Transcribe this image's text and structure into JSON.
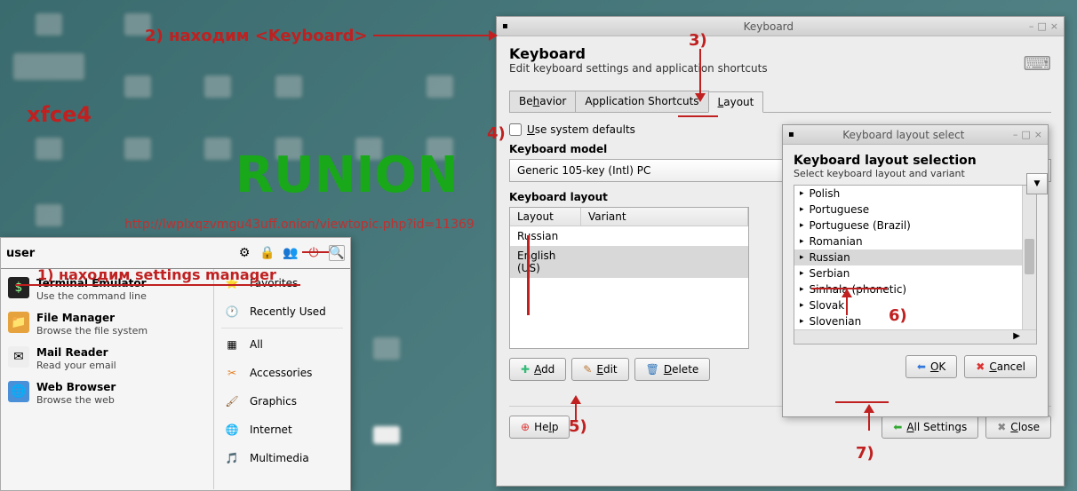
{
  "watermark": "RUNION",
  "watermark_url": "http://lwplxqzvmgu43uff.onion/viewtopic.php?id=11369",
  "xfce4_label": "xfce4",
  "annotations": {
    "a1": "1) находим settings manager",
    "a2": "2) находим <Keyboard>",
    "a3": "3)",
    "a4": "4)",
    "a5": "5)",
    "a6": "6)",
    "a7": "7)"
  },
  "menu": {
    "header_label": "user",
    "apps": [
      {
        "title": "Terminal Emulator",
        "sub": "Use the command line"
      },
      {
        "title": "File Manager",
        "sub": "Browse the file system"
      },
      {
        "title": "Mail Reader",
        "sub": "Read your email"
      },
      {
        "title": "Web Browser",
        "sub": "Browse the web"
      }
    ],
    "categories": [
      "Favorites",
      "Recently Used",
      "All",
      "Accessories",
      "Graphics",
      "Internet",
      "Multimedia"
    ]
  },
  "kbd": {
    "titlebar": "Keyboard",
    "heading": "Keyboard",
    "subheading": "Edit keyboard settings and application shortcuts",
    "tabs": {
      "behavior": "Behavior",
      "shortcuts": "Application Shortcuts",
      "layout": "Layout"
    },
    "use_defaults": "Use system defaults",
    "model_label": "Keyboard model",
    "model_value": "Generic 105-key (Intl) PC",
    "layout_label": "Keyboard layout",
    "cols": {
      "layout": "Layout",
      "variant": "Variant"
    },
    "rows": [
      {
        "layout": "Russian",
        "variant": ""
      },
      {
        "layout": "English (US)",
        "variant": ""
      }
    ],
    "buttons": {
      "add": "Add",
      "edit": "Edit",
      "delete": "Delete",
      "help": "Help",
      "all": "All Settings",
      "close": "Close"
    }
  },
  "dlg": {
    "titlebar": "Keyboard layout select",
    "heading": "Keyboard layout selection",
    "sub": "Select keyboard layout and variant",
    "langs": [
      "Polish",
      "Portuguese",
      "Portuguese (Brazil)",
      "Romanian",
      "Russian",
      "Serbian",
      "Sinhala (phonetic)",
      "Slovak",
      "Slovenian"
    ],
    "selected_index": 4,
    "ok": "OK",
    "cancel": "Cancel"
  }
}
